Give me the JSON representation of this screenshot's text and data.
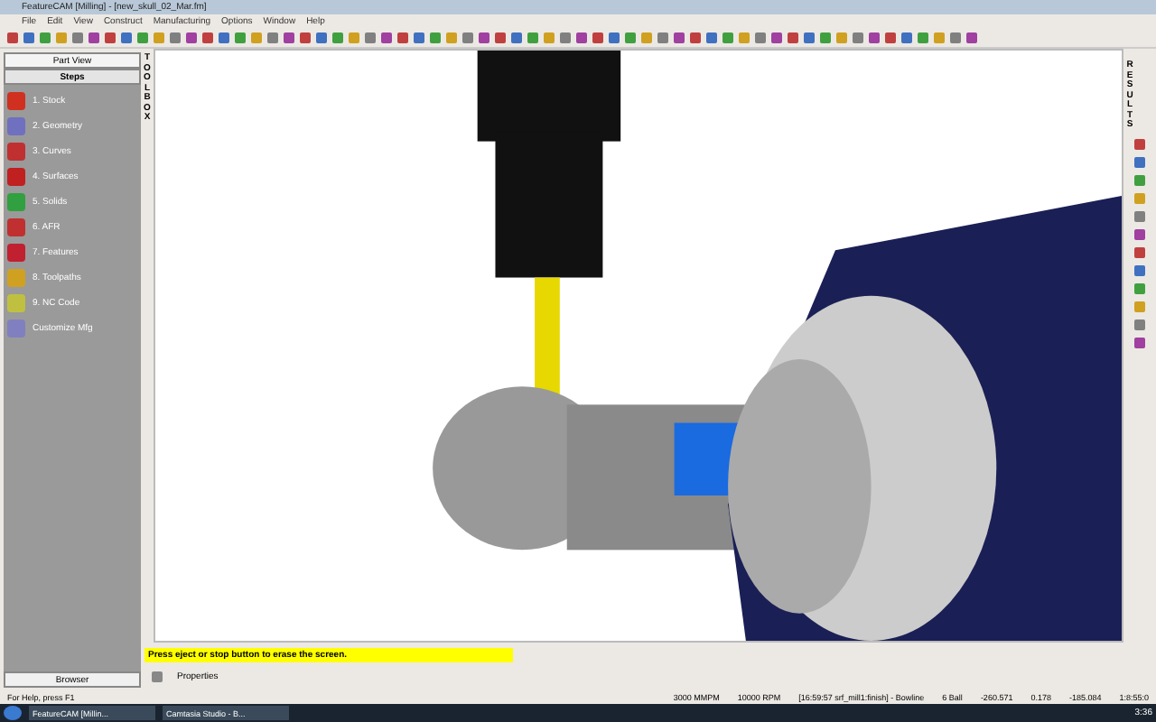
{
  "window": {
    "title": "FeatureCAM [Milling] - [new_skull_02_Mar.fm]"
  },
  "menu": [
    "File",
    "Edit",
    "View",
    "Construct",
    "Manufacturing",
    "Options",
    "Window",
    "Help"
  ],
  "toolbox_label": "TOOLBOX",
  "results_label": "RESULTS",
  "sidebar": {
    "tabs": [
      {
        "label": "Part View",
        "selected": false
      },
      {
        "label": "Steps",
        "selected": true
      }
    ],
    "items": [
      {
        "label": "1. Stock",
        "color": "#d03020"
      },
      {
        "label": "2. Geometry",
        "color": "#7070c0"
      },
      {
        "label": "3. Curves",
        "color": "#c03030"
      },
      {
        "label": "4. Surfaces",
        "color": "#c02020"
      },
      {
        "label": "5. Solids",
        "color": "#30a040"
      },
      {
        "label": "6. AFR",
        "color": "#c03030"
      },
      {
        "label": "7. Features",
        "color": "#c02030"
      },
      {
        "label": "8. Toolpaths",
        "color": "#d0a020"
      },
      {
        "label": "9. NC Code",
        "color": "#c0c040"
      },
      {
        "label": "Customize Mfg",
        "color": "#8080c0"
      }
    ],
    "footer": "Browser"
  },
  "message": "Press eject or stop button to erase the screen.",
  "properties": "Properties",
  "status_bar": {
    "help": "For Help, press F1",
    "fields": [
      "3000 MMPM",
      "10000 RPM",
      "[16:59:57 srf_mill1:finish] - Bowline",
      "6 Ball",
      "-260.571",
      "0.178",
      "-185.084",
      "1:8:55:0"
    ]
  },
  "taskbar": {
    "tasks": [
      "FeatureCAM [Millin...",
      "Camtasia Studio - B..."
    ],
    "clock": "3:36"
  }
}
